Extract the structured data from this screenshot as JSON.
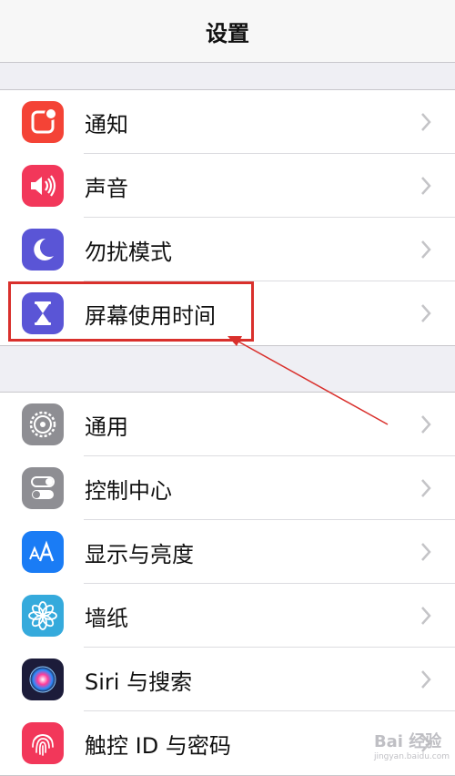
{
  "nav": {
    "title": "设置"
  },
  "group1": [
    {
      "label": "通知",
      "icon": "notifications-icon",
      "color": "#f44336"
    },
    {
      "label": "声音",
      "icon": "sound-icon",
      "color": "#f2375a"
    },
    {
      "label": "勿扰模式",
      "icon": "moon-icon",
      "color": "#5a55d6"
    },
    {
      "label": "屏幕使用时间",
      "icon": "hourglass-icon",
      "color": "#5a55d6"
    }
  ],
  "group2": [
    {
      "label": "通用",
      "icon": "gear-icon",
      "color": "#8e8e93"
    },
    {
      "label": "控制中心",
      "icon": "toggles-icon",
      "color": "#8e8e93"
    },
    {
      "label": "显示与亮度",
      "icon": "display-aa-icon",
      "color": "#1a7cf5"
    },
    {
      "label": "墙纸",
      "icon": "flower-icon",
      "color": "#35aadc"
    },
    {
      "label": "Siri 与搜索",
      "icon": "siri-icon",
      "color": "#1c1c3a"
    },
    {
      "label": "触控 ID 与密码",
      "icon": "fingerprint-icon",
      "color": "#f2375a"
    }
  ],
  "watermark": {
    "text": "Bai 经验",
    "sub": "jingyan.baidu.com"
  }
}
